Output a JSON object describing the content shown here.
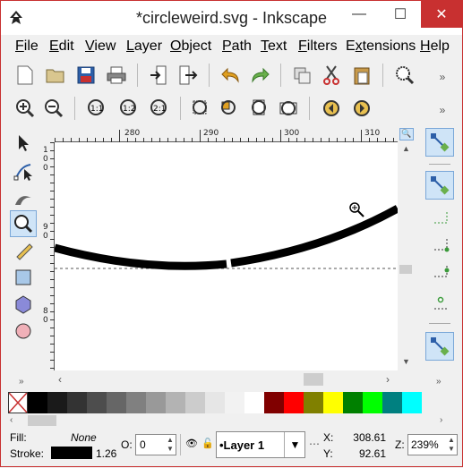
{
  "window": {
    "title": "*circleweird.svg - Inkscape",
    "minimize": "—",
    "maximize": "☐",
    "close": "✕"
  },
  "menu": [
    {
      "label": "File",
      "key": "F",
      "rest": "ile"
    },
    {
      "label": "Edit",
      "key": "E",
      "rest": "dit"
    },
    {
      "label": "View",
      "key": "V",
      "rest": "iew"
    },
    {
      "label": "Layer",
      "key": "L",
      "rest": "ayer"
    },
    {
      "label": "Object",
      "key": "O",
      "rest": "bject"
    },
    {
      "label": "Path",
      "key": "P",
      "rest": "ath"
    },
    {
      "label": "Text",
      "key": "T",
      "rest": "ext"
    },
    {
      "label": "Filters",
      "key": "F",
      "rest": "ilters"
    },
    {
      "label": "Extensions",
      "key": "x",
      "pre": "E",
      "rest": "tensions"
    },
    {
      "label": "Help",
      "key": "H",
      "rest": "elp"
    }
  ],
  "ruler": {
    "h_ticks": [
      "280",
      "290",
      "300",
      "310"
    ],
    "v_ticks": [
      "1",
      "0",
      "0",
      "9",
      "0",
      "8",
      "0"
    ]
  },
  "palette": {
    "colors": [
      "#000000",
      "#1a1a1a",
      "#333333",
      "#4d4d4d",
      "#666666",
      "#808080",
      "#999999",
      "#b3b3b3",
      "#cccccc",
      "#e6e6e6",
      "#f2f2f2",
      "#ffffff",
      "#800000",
      "#ff0000",
      "#808000",
      "#ffff00",
      "#008000",
      "#00ff00",
      "#008080",
      "#00ffff"
    ]
  },
  "status": {
    "fill_label": "Fill:",
    "fill_value": "None",
    "stroke_label": "Stroke:",
    "stroke_width": "1.26",
    "opacity_label": "O:",
    "opacity_value": "0",
    "layer": "•Layer 1",
    "x_label": "X:",
    "x_value": "308.61",
    "y_label": "Y:",
    "y_value": "92.61",
    "zoom_label": "Z:",
    "zoom_value": "239%"
  },
  "colors": {
    "accent": "#c83030",
    "selected_tool": "#cfe4f7"
  }
}
